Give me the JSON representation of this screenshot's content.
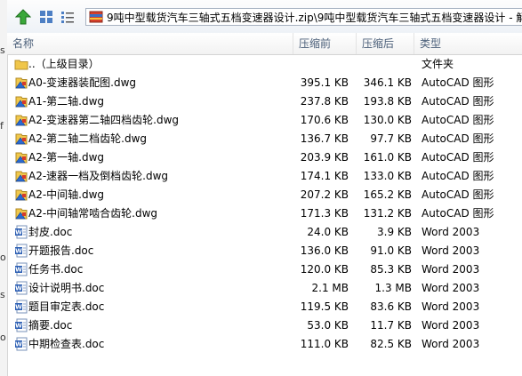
{
  "address": {
    "path": "9吨中型载货汽车三轴式五档变速器设计.zip\\9吨中型载货汽车三轴式五档变速器设计 - 解"
  },
  "columns": {
    "name": "名称",
    "size": "压缩前",
    "packed": "压缩后",
    "type": "类型"
  },
  "rows": [
    {
      "name": "..（上级目录）",
      "size": "",
      "packed": "",
      "type": "文件夹",
      "icon": "folder-icon"
    },
    {
      "name": "A0-变速器装配图.dwg",
      "size": "395.1 KB",
      "packed": "346.1 KB",
      "type": "AutoCAD 图形",
      "icon": "dwg-file-icon"
    },
    {
      "name": "A1-第二轴.dwg",
      "size": "237.8 KB",
      "packed": "193.8 KB",
      "type": "AutoCAD 图形",
      "icon": "dwg-file-icon"
    },
    {
      "name": "A2-变速器第二轴四档齿轮.dwg",
      "size": "170.6 KB",
      "packed": "130.0 KB",
      "type": "AutoCAD 图形",
      "icon": "dwg-file-icon"
    },
    {
      "name": "A2-第二轴二档齿轮.dwg",
      "size": "136.7 KB",
      "packed": "97.7 KB",
      "type": "AutoCAD 图形",
      "icon": "dwg-file-icon"
    },
    {
      "name": "A2-第一轴.dwg",
      "size": "203.9 KB",
      "packed": "161.0 KB",
      "type": "AutoCAD 图形",
      "icon": "dwg-file-icon"
    },
    {
      "name": "A2-速器一档及倒档齿轮.dwg",
      "size": "174.1 KB",
      "packed": "133.0 KB",
      "type": "AutoCAD 图形",
      "icon": "dwg-file-icon"
    },
    {
      "name": "A2-中间轴.dwg",
      "size": "207.2 KB",
      "packed": "165.2 KB",
      "type": "AutoCAD 图形",
      "icon": "dwg-file-icon"
    },
    {
      "name": "A2-中间轴常啮合齿轮.dwg",
      "size": "171.3 KB",
      "packed": "131.2 KB",
      "type": "AutoCAD 图形",
      "icon": "dwg-file-icon"
    },
    {
      "name": "封皮.doc",
      "size": "24.0 KB",
      "packed": "3.9 KB",
      "type": "Word 2003",
      "icon": "word-doc-icon"
    },
    {
      "name": "开题报告.doc",
      "size": "136.0 KB",
      "packed": "91.0 KB",
      "type": "Word 2003",
      "icon": "word-doc-icon"
    },
    {
      "name": "任务书.doc",
      "size": "120.0 KB",
      "packed": "85.3 KB",
      "type": "Word 2003",
      "icon": "word-doc-icon"
    },
    {
      "name": "设计说明书.doc",
      "size": "2.1 MB",
      "packed": "1.3 MB",
      "type": "Word 2003",
      "icon": "word-doc-icon"
    },
    {
      "name": "题目审定表.doc",
      "size": "119.5 KB",
      "packed": "83.6 KB",
      "type": "Word 2003",
      "icon": "word-doc-icon"
    },
    {
      "name": "摘要.doc",
      "size": "53.0 KB",
      "packed": "11.7 KB",
      "type": "Word 2003",
      "icon": "word-doc-icon"
    },
    {
      "name": "中期检查表.doc",
      "size": "111.0 KB",
      "packed": "82.5 KB",
      "type": "Word 2003",
      "icon": "word-doc-icon"
    }
  ]
}
